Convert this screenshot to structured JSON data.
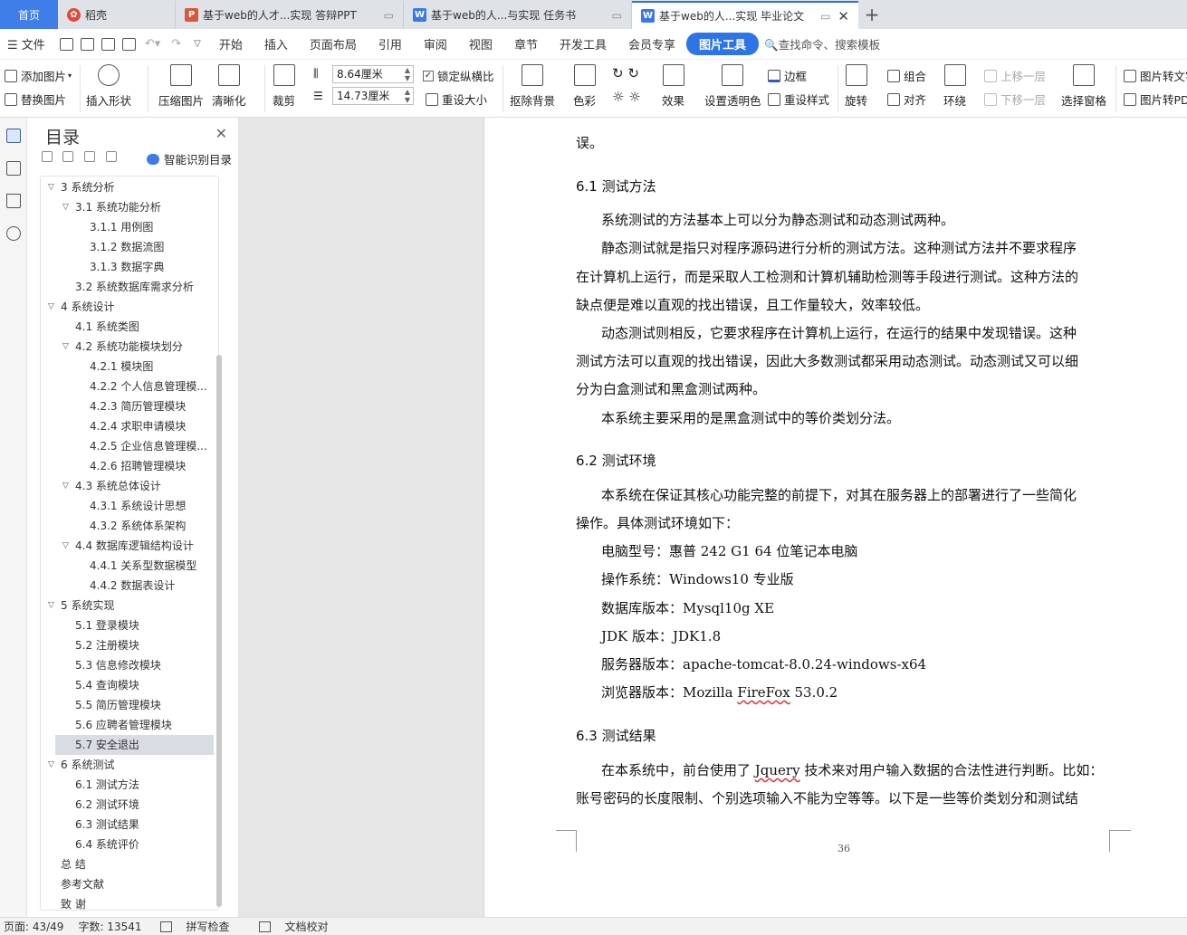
{
  "tabs": [
    {
      "label": "首页",
      "type": "home"
    },
    {
      "label": "稻壳",
      "icon": "daoke-icon"
    },
    {
      "label": "基于web的人才...实现 答辩PPT",
      "icon": "ppt-icon"
    },
    {
      "label": "基于web的人...与实现 任务书",
      "icon": "word-icon"
    },
    {
      "label": "基于web的人...实现 毕业论文",
      "icon": "word-icon",
      "active": true
    }
  ],
  "menu": {
    "file": "文件",
    "items": [
      "开始",
      "插入",
      "页面布局",
      "引用",
      "审阅",
      "视图",
      "章节",
      "开发工具",
      "会员专享"
    ],
    "active": "图片工具",
    "search": "查找命令、搜索模板"
  },
  "ribbon": {
    "add_image": "添加图片",
    "replace_image": "替换图片",
    "insert_shape": "插入形状",
    "compress": "压缩图片",
    "clarity": "清晰化",
    "crop": "裁剪",
    "width": "8.64厘米",
    "height": "14.73厘米",
    "lock_ratio": "锁定纵横比",
    "reset_size": "重设大小",
    "remove_bg": "抠除背景",
    "color": "色彩",
    "effect": "效果",
    "set_transparent": "设置透明色",
    "border": "边框",
    "reset_style": "重设样式",
    "rotate": "旋转",
    "group": "组合",
    "align": "对齐",
    "wrap": "环绕",
    "bring_forward": "上移一层",
    "send_backward": "下移一层",
    "selection_pane": "选择窗格",
    "to_text": "图片转文字",
    "to_pdf": "图片转PDF"
  },
  "toc": {
    "title": "目录",
    "smart": "智能识别目录",
    "items": [
      {
        "text": "3  系统分析",
        "level": 1,
        "caret": "v"
      },
      {
        "text": "3.1  系统功能分析",
        "level": 2,
        "caret": "v"
      },
      {
        "text": "3.1.1  用例图",
        "level": 3
      },
      {
        "text": "3.1.2  数据流图",
        "level": 3
      },
      {
        "text": "3.1.3  数据字典",
        "level": 3
      },
      {
        "text": "3.2  系统数据库需求分析",
        "level": 2
      },
      {
        "text": "4  系统设计",
        "level": 1,
        "caret": "v"
      },
      {
        "text": "4.1  系统类图",
        "level": 2
      },
      {
        "text": "4.2 系统功能模块划分",
        "level": 2,
        "caret": "v"
      },
      {
        "text": "4.2.1  模块图",
        "level": 3
      },
      {
        "text": "4.2.2  个人信息管理模...",
        "level": 3
      },
      {
        "text": "4.2.3  简历管理模块",
        "level": 3
      },
      {
        "text": "4.2.4  求职申请模块",
        "level": 3
      },
      {
        "text": "4.2.5  企业信息管理模...",
        "level": 3
      },
      {
        "text": "4.2.6  招聘管理模块",
        "level": 3
      },
      {
        "text": "4.3 系统总体设计",
        "level": 2,
        "caret": "v"
      },
      {
        "text": "4.3.1  系统设计思想",
        "level": 3
      },
      {
        "text": "4.3.2  系统体系架构",
        "level": 3
      },
      {
        "text": "4.4  数据库逻辑结构设计",
        "level": 2,
        "caret": "v"
      },
      {
        "text": "4.4.1  关系型数据模型",
        "level": 3
      },
      {
        "text": "4.4.2  数据表设计",
        "level": 3
      },
      {
        "text": "5  系统实现",
        "level": 1,
        "caret": "v"
      },
      {
        "text": "5.1  登录模块",
        "level": 2
      },
      {
        "text": "5.2  注册模块",
        "level": 2
      },
      {
        "text": "5.3  信息修改模块",
        "level": 2
      },
      {
        "text": "5.4  查询模块",
        "level": 2
      },
      {
        "text": "5.5  简历管理模块",
        "level": 2
      },
      {
        "text": "5.6  应聘者管理模块",
        "level": 2
      },
      {
        "text": "5.7  安全退出",
        "level": 2,
        "selected": true
      },
      {
        "text": "6  系统测试",
        "level": 1,
        "caret": "v"
      },
      {
        "text": "6.1  测试方法",
        "level": 2
      },
      {
        "text": "6.2 测试环境",
        "level": 2
      },
      {
        "text": "6.3 测试结果",
        "level": 2
      },
      {
        "text": "6.4 系统评价",
        "level": 2
      },
      {
        "text": "总    结",
        "level": 0
      },
      {
        "text": "参考文献",
        "level": 0
      },
      {
        "text": "致  谢",
        "level": 0
      }
    ]
  },
  "doc": {
    "l0": "误。",
    "h1": "6.1  测试方法",
    "l1": "系统测试的方法基本上可以分为静态测试和动态测试两种。",
    "l2": "静态测试就是指只对程序源码进行分析的测试方法。这种测试方法并不要求程序",
    "l3": "在计算机上运行，而是采取人工检测和计算机辅助检测等手段进行测试。这种方法的",
    "l4": "缺点便是难以直观的找出错误，且工作量较大，效率较低。",
    "l5": "动态测试则相反，它要求程序在计算机上运行，在运行的结果中发现错误。这种",
    "l6": "测试方法可以直观的找出错误，因此大多数测试都采用动态测试。动态测试又可以细",
    "l7": "分为白盒测试和黑盒测试两种。",
    "l8": "本系统主要采用的是黑盒测试中的等价类划分法。",
    "h2": "6.2 测试环境",
    "l9": "本系统在保证其核心功能完整的前提下，对其在服务器上的部署进行了一些简化",
    "l10": "操作。具体测试环境如下：",
    "l11": "电脑型号：惠普 242 G1 64 位笔记本电脑",
    "l12": "操作系统：Windows10 专业版",
    "l13": "数据库版本：Mysql10g XE",
    "l14": "JDK 版本：JDK1.8",
    "l15": "服务器版本：apache-tomcat-8.0.24-windows-x64",
    "l16a": "浏览器版本：Mozilla ",
    "l16b": "FireFox",
    "l16c": " 53.0.2",
    "h3": "6.3 测试结果",
    "l17a": "在本系统中，前台使用了 ",
    "l17b": "Jquery",
    "l17c": " 技术来对用户输入数据的合法性进行判断。比如：",
    "l18": "账号密码的长度限制、个别选项输入不能为空等等。以下是一些等价类划分和测试结",
    "page_number": "36"
  },
  "status": {
    "page": "页面: 43/49",
    "words": "字数: 13541",
    "spell": "拼写检查",
    "proof": "文档校对"
  }
}
